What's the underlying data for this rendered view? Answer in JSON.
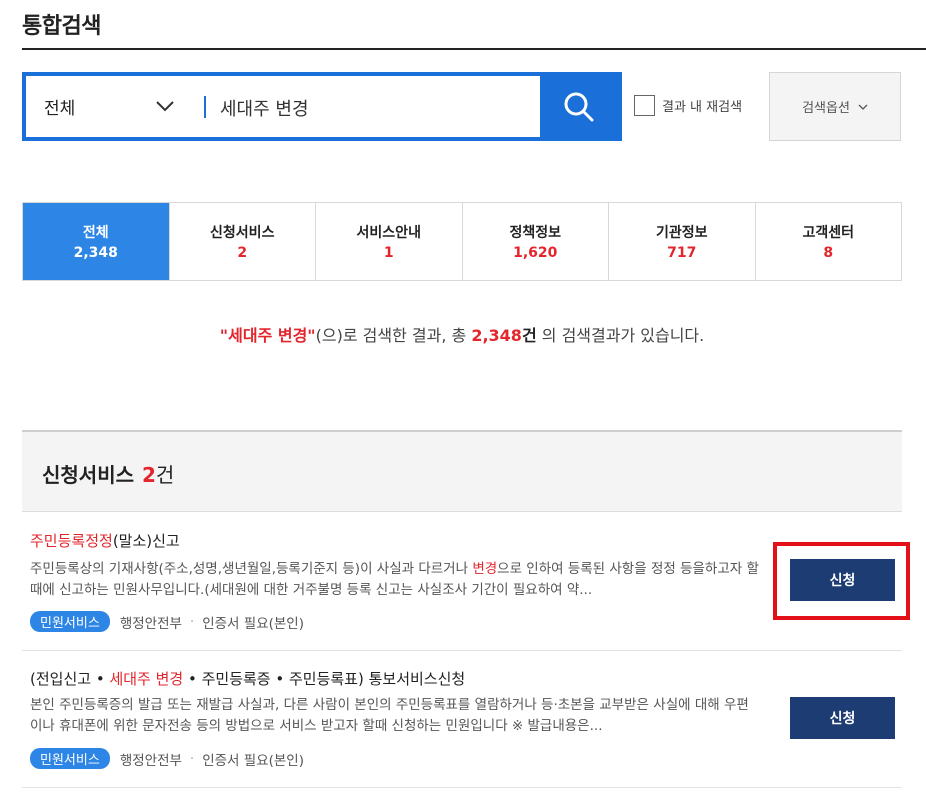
{
  "page": {
    "title": "통합검색"
  },
  "search": {
    "scope": "전체",
    "query": "세대주 변경",
    "recheck_label": "결과 내 재검색",
    "options_label": "검색옵션"
  },
  "tabs": [
    {
      "label": "전체",
      "count": "2,348",
      "active": true
    },
    {
      "label": "신청서비스",
      "count": "2"
    },
    {
      "label": "서비스안내",
      "count": "1"
    },
    {
      "label": "정책정보",
      "count": "1,620"
    },
    {
      "label": "기관정보",
      "count": "717"
    },
    {
      "label": "고객센터",
      "count": "8"
    }
  ],
  "summary": {
    "q_open": "\"",
    "keyword": "세대주 변경",
    "q_close": "\"",
    "text1": "(으)로 검색한 결과, 총 ",
    "total": "2,348",
    "unit": "건",
    "text2": " 의 검색결과가 있습니다."
  },
  "section": {
    "title": "신청서비스",
    "count": "2",
    "unit": "건"
  },
  "results": [
    {
      "title_hl": "주민등록정정",
      "title_rest": "(말소)신고",
      "desc_1": "주민등록상의 기재사항(주소,성명,생년월일,등록기준지 등)이 사실과 다르거나 ",
      "desc_hl": "변경",
      "desc_2": "으로 인하여 등록된 사항을 정정 등을하고자 할 때에 신고하는 민원사무입니다.(세대원에 대한 거주불명 등록 신고는 사실조사 기간이 필요하여 약...",
      "badge": "민원서비스",
      "agency": "행정안전부",
      "cert": "인증서 필요(본인)",
      "button": "신청"
    },
    {
      "title_1": "(전입신고 • ",
      "title_hl": "세대주 변경",
      "title_2": " • 주민등록증 • 주민등록표) 통보서비스신청",
      "desc": "본인 주민등록증의 발급 또는 재발급 사실과, 다른 사람이 본인의 주민등록표를 열람하거나 등·초본을 교부받은 사실에 대해 우편이나 휴대폰에 위한 문자전송 등의 방법으로 서비스 받고자 할때 신청하는 민원입니다 ※ 발급내용은...",
      "badge": "민원서비스",
      "agency": "행정안전부",
      "cert": "인증서 필요(본인)",
      "button": "신청"
    }
  ],
  "colors": {
    "accent": "#1a6fd8",
    "tab_active": "#2d86e6",
    "highlight": "#e3262d",
    "apply_button": "#1d3c73",
    "annotation": "#e3101a"
  }
}
